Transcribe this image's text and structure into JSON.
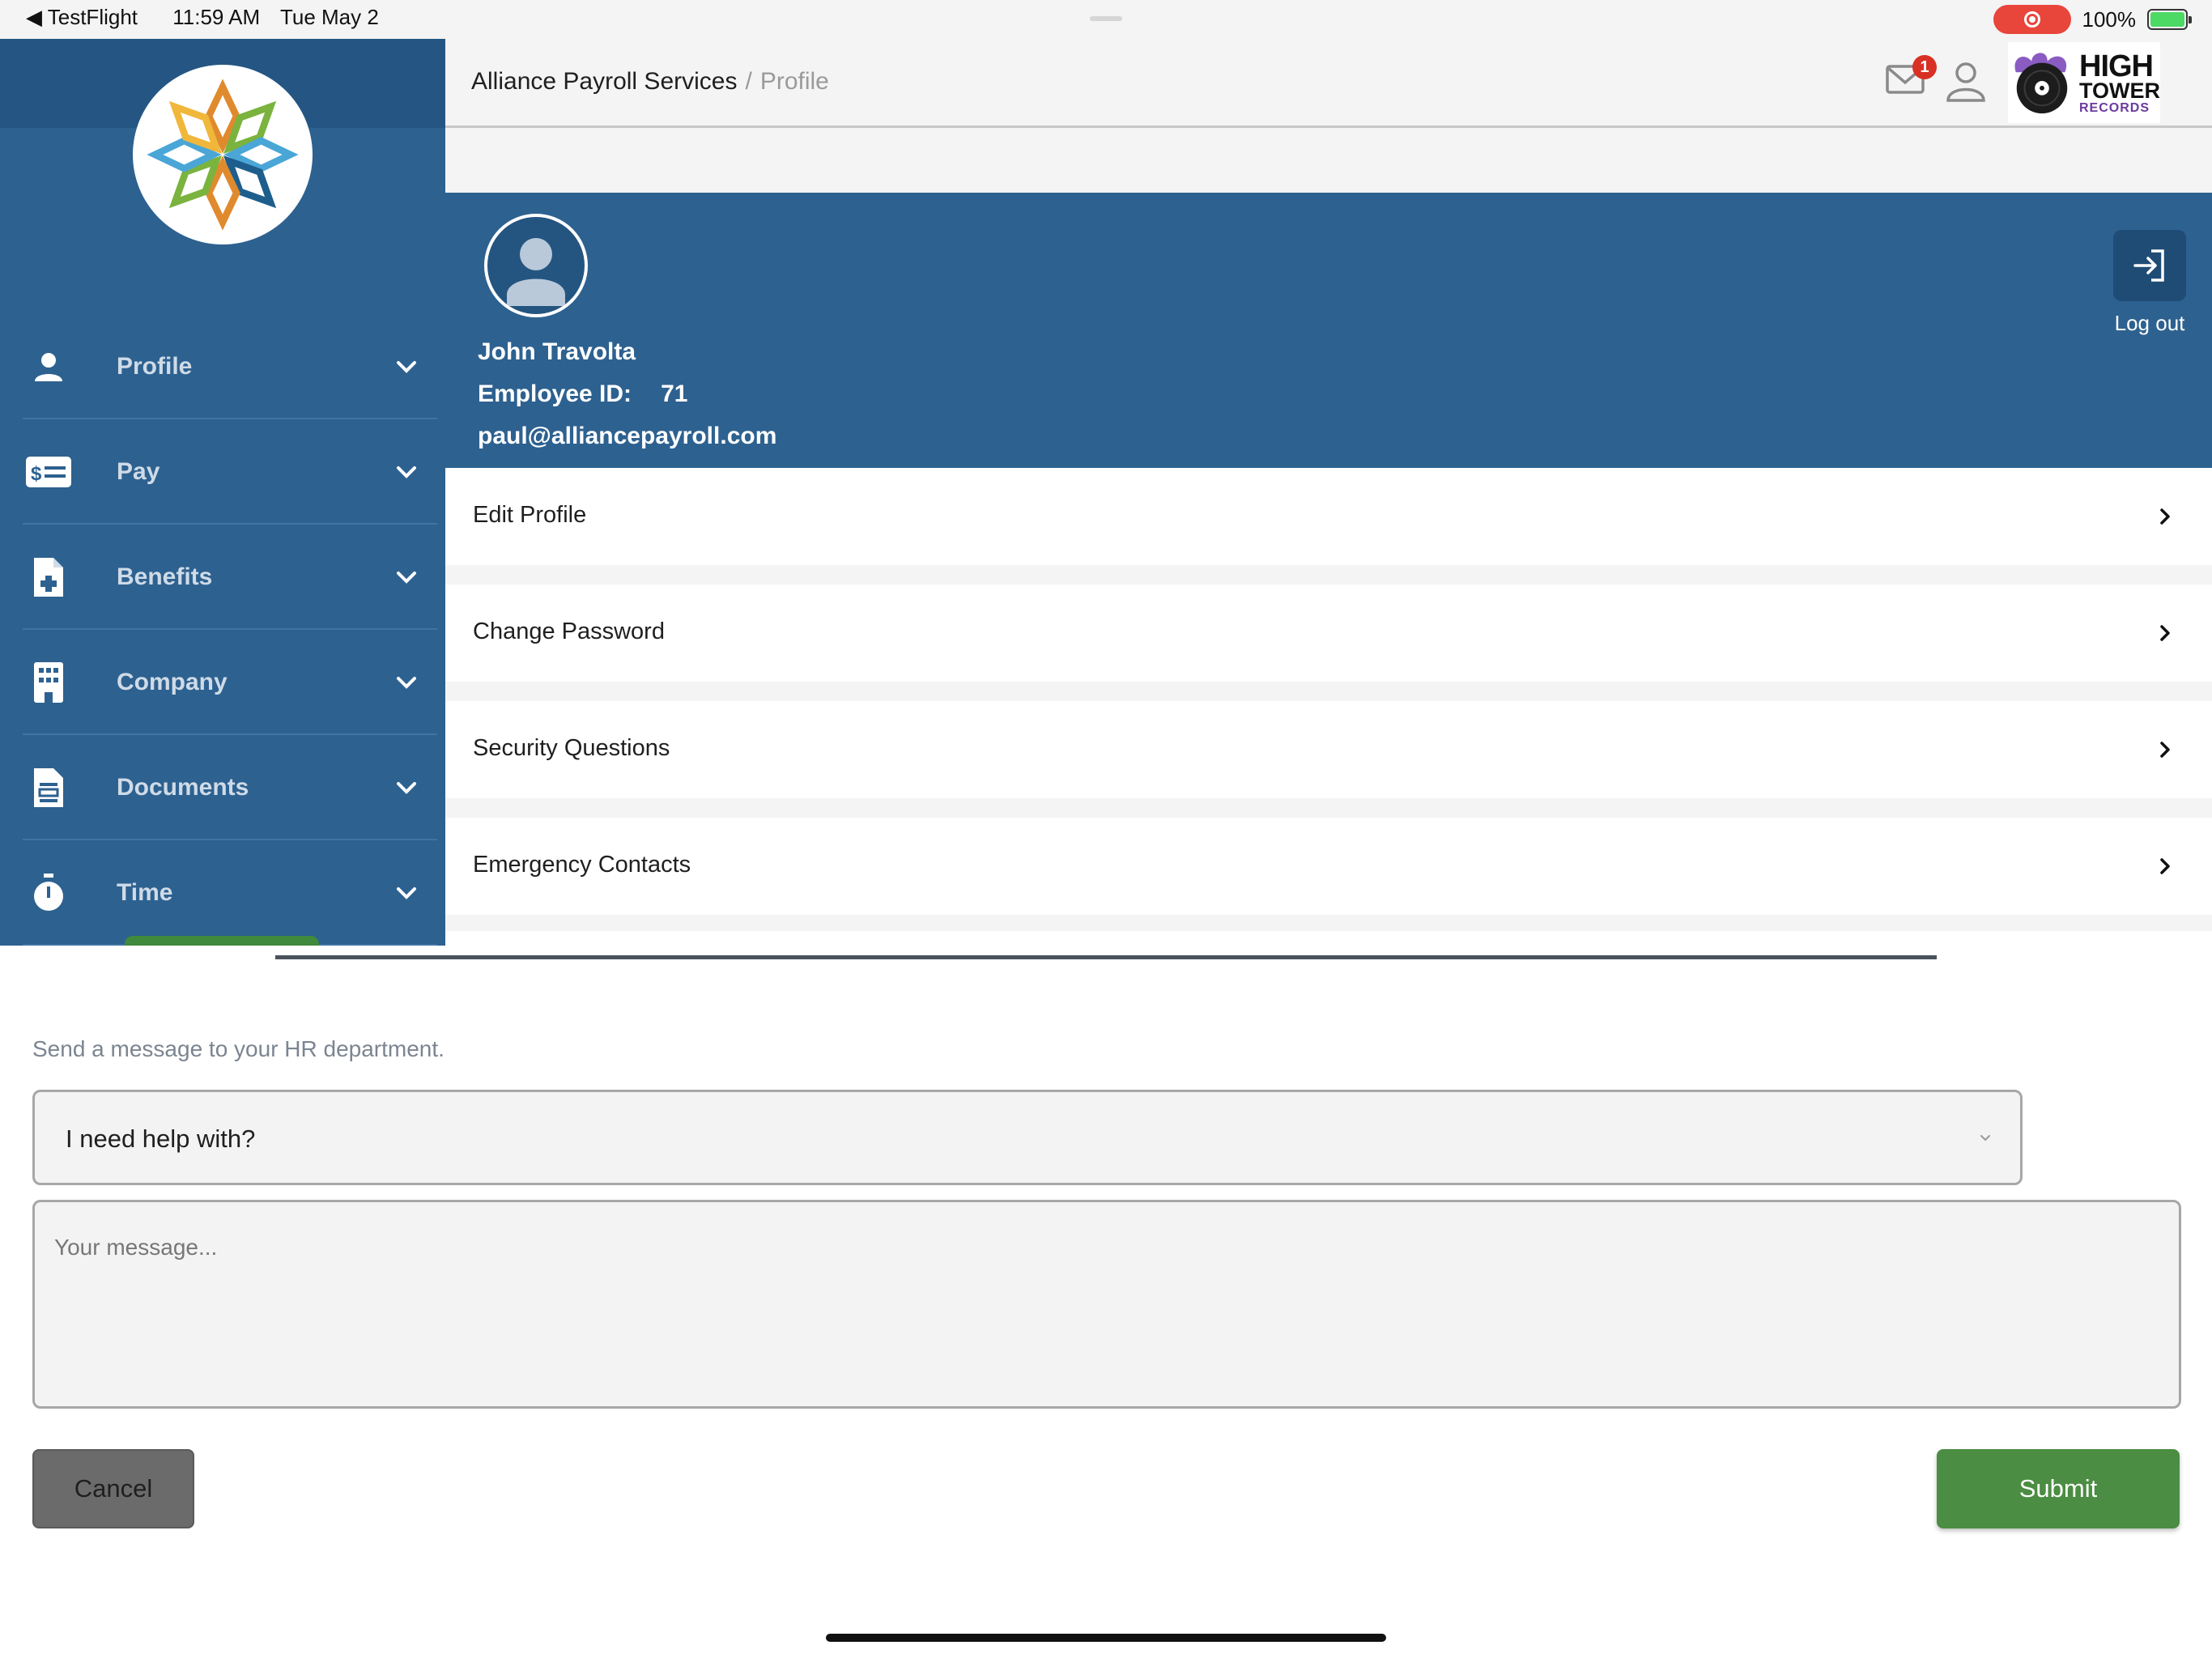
{
  "status_bar": {
    "back_app": "TestFlight",
    "time": "11:59 AM",
    "date": "Tue May 2",
    "battery": "100%"
  },
  "sidebar": {
    "items": [
      {
        "label": "Profile",
        "icon": "person-icon"
      },
      {
        "label": "Pay",
        "icon": "pay-card-icon"
      },
      {
        "label": "Benefits",
        "icon": "medical-document-icon"
      },
      {
        "label": "Company",
        "icon": "building-icon"
      },
      {
        "label": "Documents",
        "icon": "document-icon"
      },
      {
        "label": "Time",
        "icon": "stopwatch-icon"
      }
    ]
  },
  "header": {
    "breadcrumb_home": "Alliance Payroll Services",
    "breadcrumb_separator": "/",
    "breadcrumb_current": "Profile",
    "mail_badge": "1",
    "brand_line1": "HIGH",
    "brand_line2": "TOWER",
    "brand_line3": "RECORDS"
  },
  "profile": {
    "name": "John Travolta",
    "employee_id_label": "Employee ID:",
    "employee_id": "71",
    "email": "paul@alliancepayroll.com",
    "logout_label": "Log out"
  },
  "menu": [
    {
      "label": "Edit Profile"
    },
    {
      "label": "Change Password"
    },
    {
      "label": "Security Questions"
    },
    {
      "label": "Emergency Contacts"
    }
  ],
  "hr_form": {
    "hint": "Send a message to your HR department.",
    "select_value": "I need help with?",
    "message_placeholder": "Your message...",
    "cancel_label": "Cancel",
    "submit_label": "Submit"
  },
  "colors": {
    "sidebar_blue": "#2d6190",
    "submit_green": "#4b8d42",
    "badge_red": "#d93025"
  }
}
